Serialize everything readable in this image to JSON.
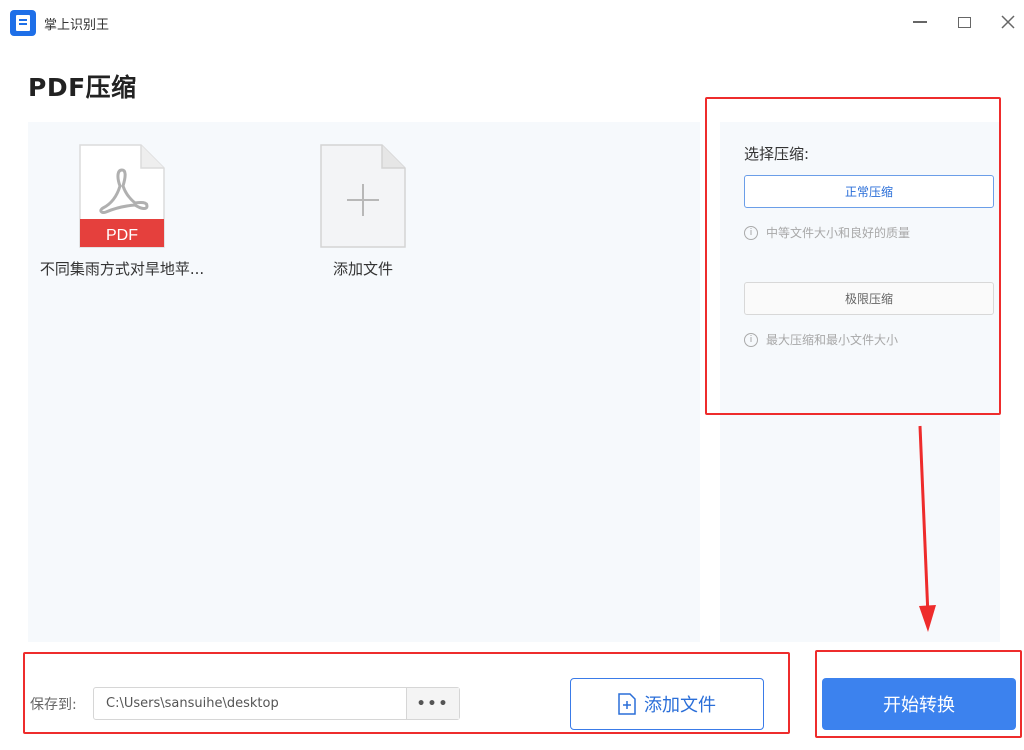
{
  "window": {
    "app_title": "掌上识别王",
    "minimize_icon": "minimize-icon",
    "maximize_icon": "maximize-icon",
    "close_icon": "close-icon"
  },
  "page": {
    "title": "PDF压缩"
  },
  "files": [
    {
      "name": "不同集雨方式对旱地苹...",
      "badge": "PDF",
      "icon": "pdf-file-icon"
    }
  ],
  "add_tile": {
    "label": "添加文件",
    "icon": "add-file-plus-icon"
  },
  "options": {
    "title": "选择压缩:",
    "normal": {
      "label": "正常压缩",
      "hint": "中等文件大小和良好的质量",
      "selected": true
    },
    "max": {
      "label": "极限压缩",
      "hint": "最大压缩和最小文件大小",
      "selected": false
    },
    "info_icon_glyph": "i"
  },
  "bottom": {
    "save_label": "保存到:",
    "save_path": "C:\\Users\\sansuihe\\desktop",
    "browse_label": "•••",
    "add_file_label": "添加文件",
    "start_label": "开始转换"
  },
  "colors": {
    "accent": "#3c82ee",
    "annotation_red": "#ee2c2c",
    "pdf_red": "#e5403d"
  }
}
